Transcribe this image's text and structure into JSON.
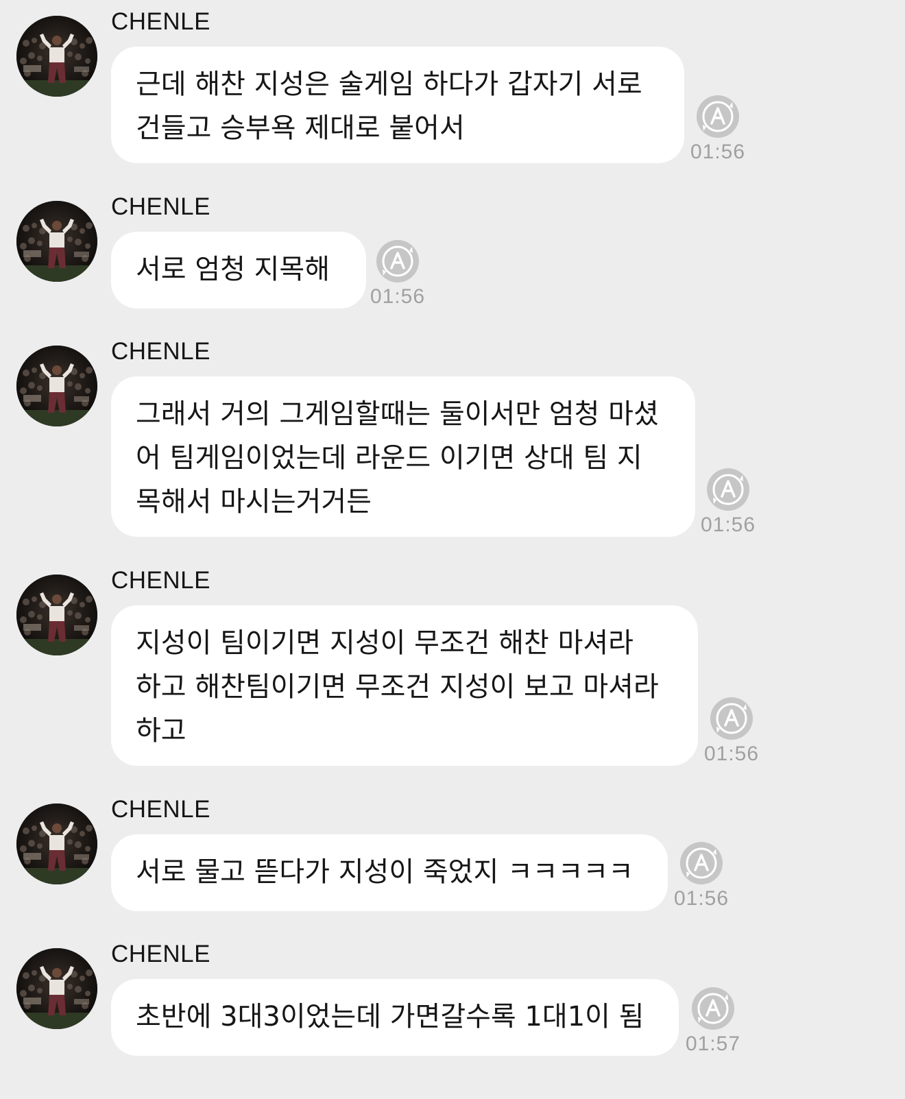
{
  "chat": {
    "messages": [
      {
        "sender": "CHENLE",
        "text": "근데 해찬 지성은 술게임 하다가 갑자기 서로\n건들고 승부욕 제대로 붙어서",
        "time": "01:56"
      },
      {
        "sender": "CHENLE",
        "text": "서로 엄청 지목해",
        "time": "01:56"
      },
      {
        "sender": "CHENLE",
        "text": "그래서 거의 그게임할때는 둘이서만 엄청 마셨\n어 팀게임이었는데 라운드 이기면 상대 팀 지\n목해서 마시는거거든",
        "time": "01:56"
      },
      {
        "sender": "CHENLE",
        "text": "지성이 팀이기면 지성이 무조건 해찬 마셔라\n하고 해찬팀이기면 무조건 지성이 보고 마셔라\n하고",
        "time": "01:56"
      },
      {
        "sender": "CHENLE",
        "text": "서로 물고 뜯다가 지성이 죽었지 ㅋㅋㅋㅋㅋ",
        "time": "01:56"
      },
      {
        "sender": "CHENLE",
        "text": "초반에 3대3이었는데 가면갈수록 1대1이 됨",
        "time": "01:57"
      }
    ]
  },
  "colors": {
    "background": "#ededed",
    "bubble": "#ffffff",
    "text": "#161616",
    "timestamp": "#a0a0a0",
    "icon": "#c6c6c6"
  },
  "icons": {
    "avatar": "profile-photo",
    "translate": "translate-a-icon"
  }
}
